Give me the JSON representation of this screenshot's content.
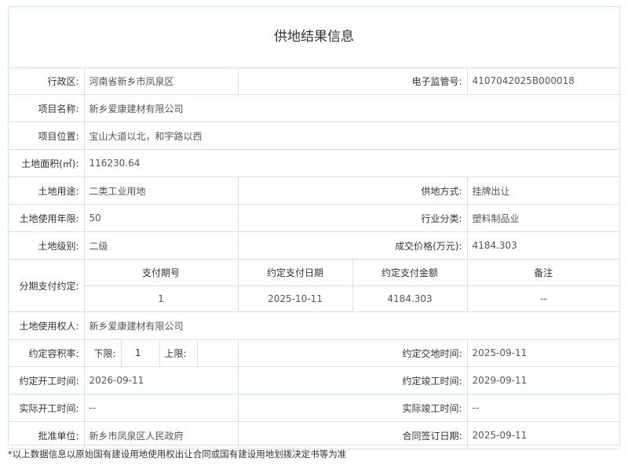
{
  "title": "供地结果信息",
  "fields": {
    "district_label": "行政区:",
    "district_value": "河南省新乡市凤泉区",
    "supervision_label": "电子监管号:",
    "supervision_value": "4107042025B000018",
    "project_name_label": "项目名称:",
    "project_name_value": "新乡爱康建材有限公司",
    "project_location_label": "项目位置:",
    "project_location_value": "宝山大道以北，和宇路以西",
    "area_label": "土地面积(㎡):",
    "area_value": "116230.64",
    "land_use_label": "土地用途:",
    "land_use_value": "二类工业用地",
    "supply_method_label": "供地方式:",
    "supply_method_value": "挂牌出让",
    "use_years_label": "土地使用年限:",
    "use_years_value": "50",
    "industry_label": "行业分类:",
    "industry_value": "塑料制品业",
    "land_grade_label": "土地级别:",
    "land_grade_value": "二级",
    "price_label": "成交价格(万元):",
    "price_value": "4184.303",
    "installment_label": "分期支付约定:",
    "land_user_label": "土地使用权人:",
    "land_user_value": "新乡爱康建材有限公司",
    "far_label": "约定容积率:",
    "far_lower_label": "下限:",
    "far_lower_value": "1",
    "far_upper_label": "上限:",
    "far_upper_value": "",
    "delivery_time_label": "约定交地时间:",
    "delivery_time_value": "2025-09-11",
    "start_time_label": "约定开工时间:",
    "start_time_value": "2026-09-11",
    "finish_time_label": "约定竣工时间:",
    "finish_time_value": "2029-09-11",
    "actual_start_label": "实际开工时间:",
    "actual_start_value": "--",
    "actual_finish_label": "实际竣工时间:",
    "actual_finish_value": "--",
    "approver_label": "批准单位:",
    "approver_value": "新乡市凤泉区人民政府",
    "contract_date_label": "合同签订日期:",
    "contract_date_value": "2025-09-11"
  },
  "installments": {
    "headers": [
      "支付期号",
      "约定支付日期",
      "约定支付金额",
      "备注"
    ],
    "rows": [
      [
        "1",
        "2025-10-11",
        "4184.303",
        "--"
      ]
    ]
  },
  "footnote": "*以上数据信息以原始国有建设用地使用权出让合同或国有建设用地划拨决定书等为准"
}
